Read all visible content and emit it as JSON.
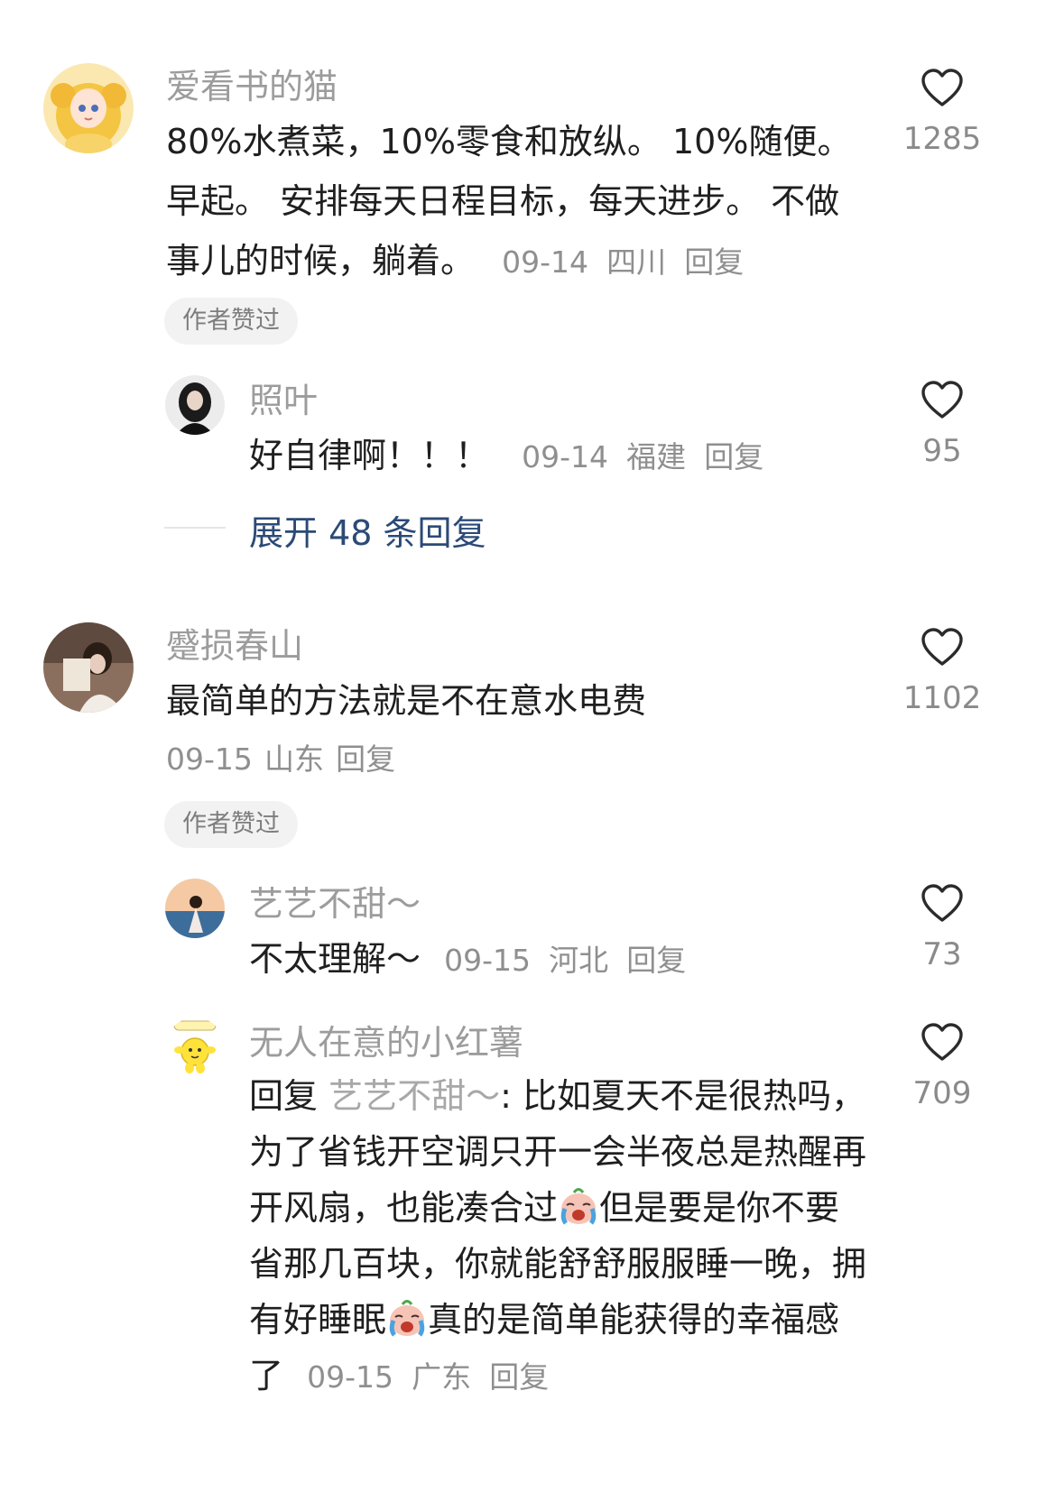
{
  "comments": [
    {
      "username": "爱看书的猫",
      "text": "80%水煮菜，10%零食和放纵。 10%随便。早起。 安排每天日程目标，每天进步。 不做事儿的时候，躺着。",
      "date": "09-14",
      "location": "四川",
      "reply_label": "回复",
      "likes": "1285",
      "badge": "作者赞过",
      "replies": [
        {
          "username": "照叶",
          "text": "好自律啊！！！",
          "date": "09-14",
          "location": "福建",
          "reply_label": "回复",
          "likes": "95"
        }
      ],
      "expand_label": "展开 48 条回复"
    },
    {
      "username": "蹙损春山",
      "text": "最简单的方法就是不在意水电费",
      "date": "09-15",
      "location": "山东",
      "reply_label": "回复",
      "likes": "1102",
      "badge": "作者赞过",
      "replies": [
        {
          "username": "艺艺不甜～",
          "text": "不太理解～",
          "date": "09-15",
          "location": "河北",
          "reply_label": "回复",
          "likes": "73"
        },
        {
          "username": "无人在意的小红薯",
          "reply_prefix": "回复",
          "mention": "艺艺不甜～",
          "text_part1": ": 比如夏天不是很热吗，为了省钱开空调只开一会半夜总是热醒再开风扇，也能凑合过",
          "text_part2": "但是要是你不要省那几百块，你就能舒舒服服睡一晚，拥有好睡眠",
          "text_part3": "真的是简单能获得的幸福感了",
          "emoji": "crying-face-icon",
          "date": "09-15",
          "location": "广东",
          "reply_label": "回复",
          "likes": "709"
        }
      ]
    }
  ],
  "colors": {
    "expand_link": "#2b4a77",
    "username": "#9c9c9c",
    "meta": "#8f8f8f"
  }
}
